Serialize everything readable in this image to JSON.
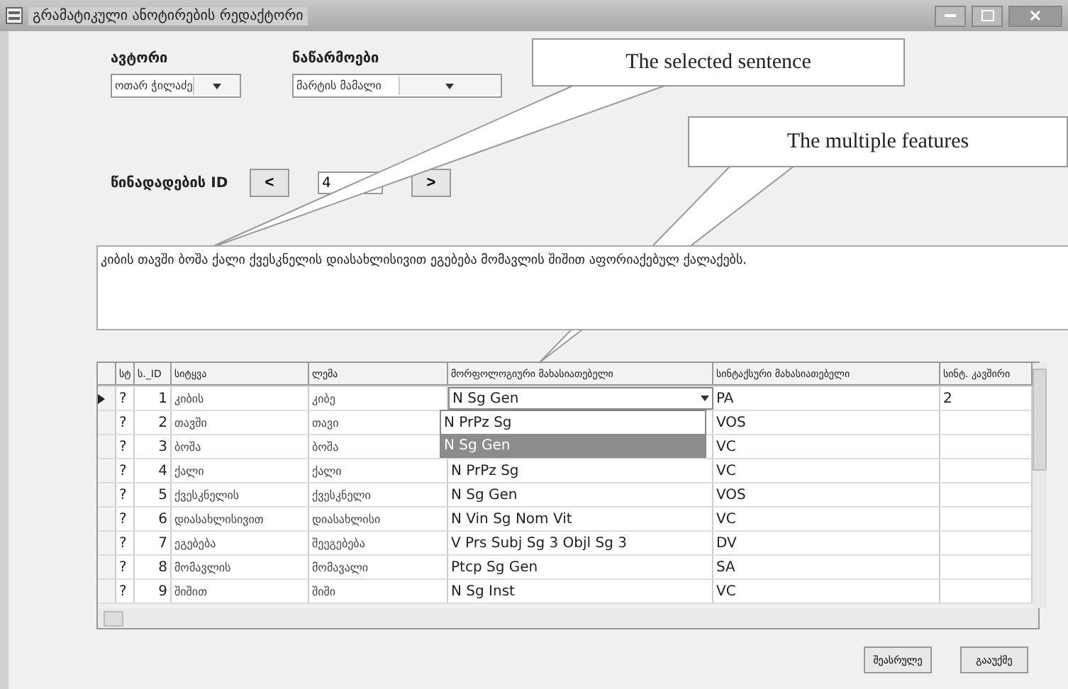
{
  "window": {
    "title": "გრამატიკული ანოტირების რედაქტორი"
  },
  "author": {
    "label": "ავტორი",
    "value": "ოთარ ჭილაძე"
  },
  "work": {
    "label": "ნაწარმოები",
    "value": "მარტის მამალი"
  },
  "sentence_id": {
    "label": "წინადადების ID",
    "prev": "<",
    "value": "4",
    "next": ">"
  },
  "sentence": "კიბის თავში ბოშა ქალი ქვესკნელის დიასახლისივით ეგებება მომავლის შიშით აფორიაქებულ ქალაქებს.",
  "table": {
    "columns": [
      "სტ",
      "ს._ID",
      "სიტყვა",
      "ლემა",
      "მორფოლოგიური მახასიათებელი",
      "სინტაქსური მახასიათებელი",
      "სინტ. კავშირი"
    ],
    "rows": [
      {
        "selected": true,
        "status": "?",
        "id": "1",
        "word": "კიბის",
        "lemma": "კიბე",
        "morph": "N Sg Gen",
        "syntax": "PA",
        "link": "2"
      },
      {
        "selected": false,
        "status": "?",
        "id": "2",
        "word": "თავში",
        "lemma": "თავი",
        "syntax": "VOS"
      },
      {
        "selected": false,
        "status": "?",
        "id": "3",
        "word": "ბოშა",
        "lemma": "ბოშა",
        "syntax": "VC"
      },
      {
        "selected": false,
        "status": "?",
        "id": "4",
        "word": "ქალი",
        "lemma": "ქალი",
        "morph": "N PrPz Sg",
        "syntax": "VC"
      },
      {
        "selected": false,
        "status": "?",
        "id": "5",
        "word": "ქვესკნელის",
        "lemma": "ქვესკნელი",
        "morph": "N Sg Gen",
        "syntax": "VOS"
      },
      {
        "selected": false,
        "status": "?",
        "id": "6",
        "word": "დიასახლისივით",
        "lemma": "დიასახლისი",
        "morph": "N Vin Sg Nom Vit",
        "syntax": "VC"
      },
      {
        "selected": false,
        "status": "?",
        "id": "7",
        "word": "ეგებება",
        "lemma": "შეეგებება",
        "morph": "V Prs Subj Sg 3 Objl Sg 3",
        "syntax": "DV"
      },
      {
        "selected": false,
        "status": "?",
        "id": "8",
        "word": "მომავლის",
        "lemma": "მომავალი",
        "morph": "Ptcp Sg Gen",
        "syntax": "SA"
      },
      {
        "selected": false,
        "status": "?",
        "id": "9",
        "word": "შიშით",
        "lemma": "შიში",
        "morph": "N Sg Inst",
        "syntax": "VC"
      }
    ],
    "dropdown_options": [
      {
        "label": "N PrPz Sg",
        "selected": false
      },
      {
        "label": "N Sg Gen",
        "selected": true
      }
    ]
  },
  "buttons": [
    "შეასრულე",
    "გააუქმე"
  ],
  "callouts": [
    "The selected sentence",
    "The multiple features"
  ]
}
